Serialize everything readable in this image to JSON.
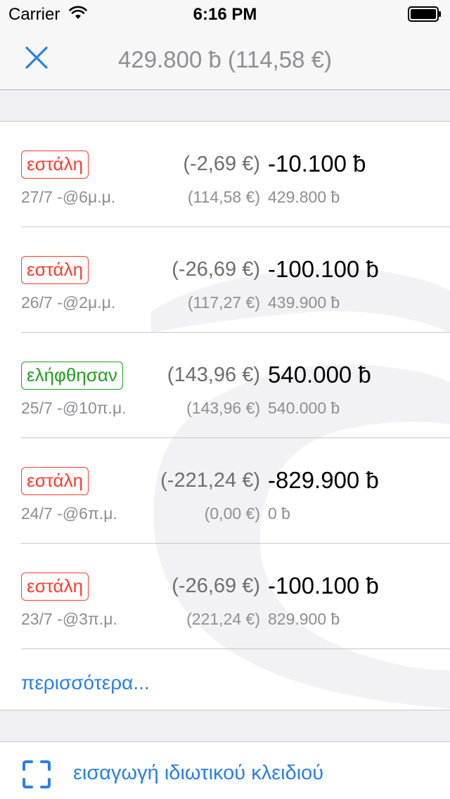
{
  "status_bar": {
    "carrier": "Carrier",
    "time": "6:16 PM",
    "wifi_icon": "wifi-icon",
    "battery_icon": "battery-full-icon"
  },
  "nav": {
    "close_icon": "close-x-icon",
    "title": "429.800 ƀ (114,58 €)",
    "accent_color": "#2980e6"
  },
  "transactions": [
    {
      "type": "sent",
      "status": "εστάλη",
      "fiat_amount": "(-2,69 €)",
      "amount": "-10.100 ƀ",
      "date": "27/7 -@6μ.μ.",
      "fiat_balance": "(114,58 €)",
      "balance": "429.800 ƀ"
    },
    {
      "type": "sent",
      "status": "εστάλη",
      "fiat_amount": "(-26,69 €)",
      "amount": "-100.100 ƀ",
      "date": "26/7 -@2μ.μ.",
      "fiat_balance": "(117,27 €)",
      "balance": "439.900 ƀ"
    },
    {
      "type": "received",
      "status": "ελήφθησαν",
      "fiat_amount": "(143,96 €)",
      "amount": "540.000 ƀ",
      "date": "25/7 -@10π.μ.",
      "fiat_balance": "(143,96 €)",
      "balance": "540.000 ƀ"
    },
    {
      "type": "sent",
      "status": "εστάλη",
      "fiat_amount": "(-221,24 €)",
      "amount": "-829.900 ƀ",
      "date": "24/7 -@6π.μ.",
      "fiat_balance": "(0,00 €)",
      "balance": "0 ƀ"
    },
    {
      "type": "sent",
      "status": "εστάλη",
      "fiat_amount": "(-26,69 €)",
      "amount": "-100.100 ƀ",
      "date": "23/7 -@3π.μ.",
      "fiat_balance": "(221,24 €)",
      "balance": "829.900 ƀ"
    }
  ],
  "more_link": "περισσότερα...",
  "import": {
    "icon": "scan-frame-icon",
    "label": "εισαγωγή ιδιωτικού κλειδιού"
  },
  "colors": {
    "sent": "#ff3b30",
    "received": "#1ea01e",
    "link": "#2980e6"
  }
}
